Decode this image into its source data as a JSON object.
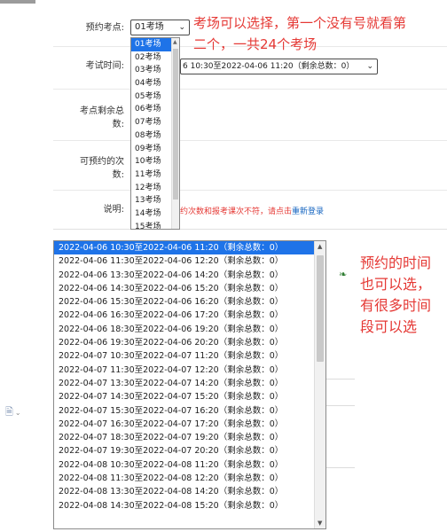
{
  "form": {
    "exam_site_label": "预约考点:",
    "exam_site_value": "01考场",
    "exam_time_label": "考试时间:",
    "exam_time_value": "2022-04-06 10:30至2022-04-06 11:20（剩余总数：0）",
    "exam_time_value_visible": "6 10:30至2022-04-06 11:20（剩余总数：0）",
    "remaining_label_1": "考点剩余总",
    "remaining_label_2": "数:",
    "bookable_label_1": "可预约的次",
    "bookable_label_2": "数:",
    "note_label": "说明:",
    "note_text": "约次数和报考课次不符，请点击",
    "note_link": "重新登录"
  },
  "site_options": [
    "01考场",
    "02考场",
    "03考场",
    "04考场",
    "05考场",
    "06考场",
    "07考场",
    "08考场",
    "09考场",
    "10考场",
    "11考场",
    "12考场",
    "13考场",
    "14考场",
    "15考场"
  ],
  "time_options": [
    "2022-04-06 10:30至2022-04-06 11:20（剩余总数：0）",
    "2022-04-06 11:30至2022-04-06 12:20（剩余总数：0）",
    "2022-04-06 13:30至2022-04-06 14:20（剩余总数：0）",
    "2022-04-06 14:30至2022-04-06 15:20（剩余总数：0）",
    "2022-04-06 15:30至2022-04-06 16:20（剩余总数：0）",
    "2022-04-06 16:30至2022-04-06 17:20（剩余总数：0）",
    "2022-04-06 18:30至2022-04-06 19:20（剩余总数：0）",
    "2022-04-06 19:30至2022-04-06 20:20（剩余总数：0）",
    "2022-04-07 10:30至2022-04-07 11:20（剩余总数：0）",
    "2022-04-07 11:30至2022-04-07 12:20（剩余总数：0）",
    "2022-04-07 13:30至2022-04-07 14:20（剩余总数：0）",
    "2022-04-07 14:30至2022-04-07 15:20（剩余总数：0）",
    "2022-04-07 15:30至2022-04-07 16:20（剩余总数：0）",
    "2022-04-07 16:30至2022-04-07 17:20（剩余总数：0）",
    "2022-04-07 18:30至2022-04-07 19:20（剩余总数：0）",
    "2022-04-07 19:30至2022-04-07 20:20（剩余总数：0）",
    "2022-04-08 10:30至2022-04-08 11:20（剩余总数：0）",
    "2022-04-08 11:30至2022-04-08 12:20（剩余总数：0）",
    "2022-04-08 13:30至2022-04-08 14:20（剩余总数：0）",
    "2022-04-08 14:30至2022-04-08 15:20（剩余总数：0）"
  ],
  "annotations": {
    "site_note": "考场可以选择，第一个没有号就看第二个，一共24个考场",
    "time_note": "预约的时间也可以选，有很多时间段可以选"
  },
  "colors": {
    "selection": "#1e73e8",
    "annotation": "#e53935",
    "link": "#1565c0"
  },
  "icons": {
    "dropdown_chevron": "chevron-down-icon",
    "document": "document-icon"
  }
}
